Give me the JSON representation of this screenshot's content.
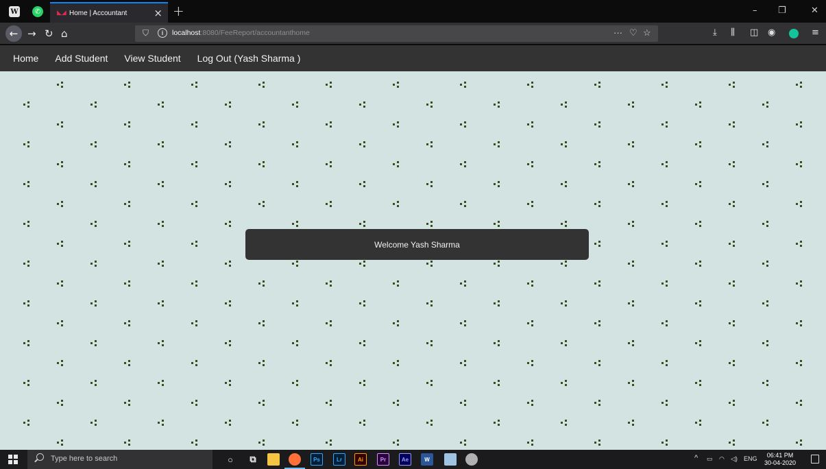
{
  "browser": {
    "tab": {
      "title": "Home | Accountant",
      "favicon": "accountant-favicon"
    },
    "address": {
      "host": "localhost",
      "path": ":8080/FeeReport/accountanthome"
    }
  },
  "site": {
    "nav": {
      "home": "Home",
      "add_student": "Add Student",
      "view_student": "View Student",
      "logout": "Log Out (Yash Sharma )"
    },
    "welcome": "Welcome Yash Sharma",
    "colors": {
      "background": "#d3e3e1",
      "nav": "#333333",
      "pattern": "#3b4a1f"
    }
  },
  "taskbar": {
    "search_placeholder": "Type here to search",
    "tray": {
      "language": "ENG"
    },
    "clock": {
      "time": "06:41 PM",
      "date": "30-04-2020"
    },
    "apps": {
      "ps": "Ps",
      "lr": "Lr",
      "ai": "Ai",
      "pr": "Pr",
      "ae": "Ae",
      "word": "W"
    }
  }
}
